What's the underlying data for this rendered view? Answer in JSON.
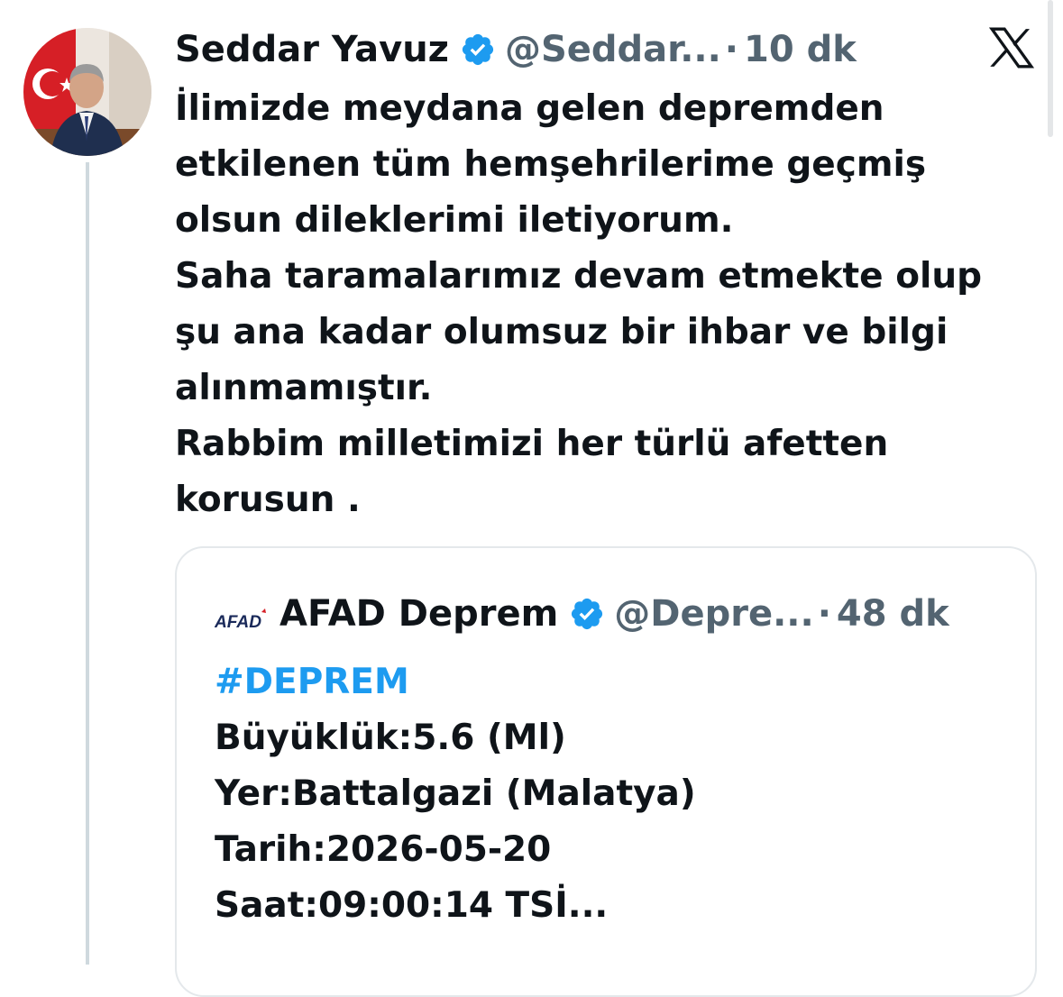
{
  "tweet": {
    "author_name": "Seddar Yavuz",
    "handle": "@Seddar...",
    "separator": "·",
    "time": "10 dk",
    "text": "İlimizde meydana gelen depremden\netkilenen tüm hemşehrilerime geçmiş\nolsun dileklerimi iletiyorum.\nSaha taramalarımız devam etmekte olup\nşu ana kadar olumsuz bir ihbar ve bilgi\nalınmamıştır.\nRabbim milletimizi her türlü afetten\nkorusun ."
  },
  "quoted_tweet": {
    "author_name": "AFAD Deprem",
    "logo_text": "AFAD",
    "handle": "@Depre...",
    "separator": "·",
    "time": "48 dk",
    "hashtag": "#DEPREM",
    "lines": [
      "Büyüklük:5.6 (Ml)",
      "Yer:Battalgazi (Malatya)",
      "Tarih:2026-05-20",
      "Saat:09:00:14 TSİ..."
    ]
  },
  "icons": {
    "verified": "verified-badge-icon",
    "platform": "x-logo-icon"
  },
  "colors": {
    "text": "#0f1419",
    "secondary": "#536471",
    "accent": "#1d9bf0",
    "border": "#e4e8eb"
  }
}
